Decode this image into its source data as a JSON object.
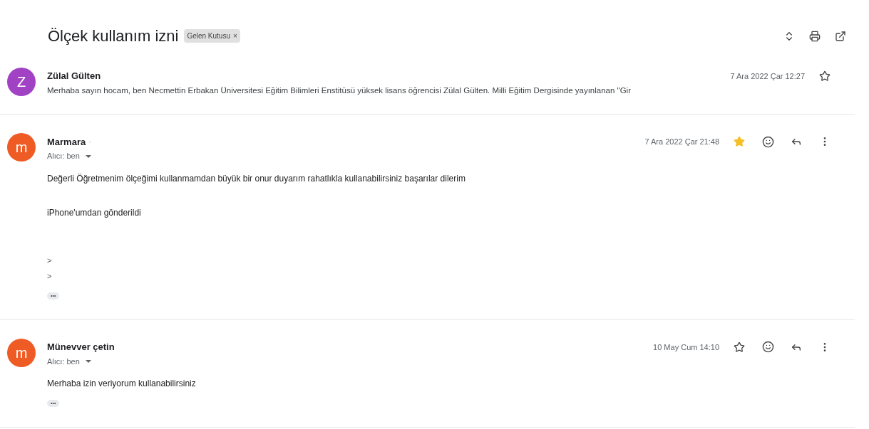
{
  "subject": "Ölçek kullanım izni",
  "label": {
    "text": "Gelen Kutusu",
    "remove": "×"
  },
  "messages": [
    {
      "kind": "collapsed",
      "avatar": "Z",
      "color": "#a142c4",
      "sender": "Zülal Gülten",
      "date": "7 Ara 2022 Çar 12:27",
      "starred": false,
      "snippet": "Merhaba sayın hocam, ben Necmettin Erbakan Üniversitesi Eğitim Bilimleri Enstitüsü yüksek lisans öğrencisi Zülal Gülten. Milli Eğitim Dergisinde yayınlanan \"Gir"
    },
    {
      "kind": "expanded",
      "avatar": "m",
      "color": "#ef5b25",
      "sender": "Marmara",
      "sender_suffix": "·",
      "date": "7 Ara 2022 Çar 21:48",
      "starred": true,
      "recipient": "Alıcı: ben",
      "body": [
        "Değerli Öğretmenim ölçeğimi kullanmamdan büyük bir onur duyarım rahatlıkla kullanabilirsiniz başarılar dilerim",
        "iPhone'umdan gönderildi"
      ],
      "quotes": [
        ">",
        ">"
      ],
      "more": "•••"
    },
    {
      "kind": "expanded",
      "avatar": "m",
      "color": "#ef5b25",
      "sender": "Münevver çetin",
      "date": "10 May Cum 14:10",
      "starred": false,
      "recipient": "Alıcı: ben",
      "body": [
        "Merhaba izin veriyorum kullanabilirsiniz"
      ],
      "more": "•••"
    }
  ]
}
